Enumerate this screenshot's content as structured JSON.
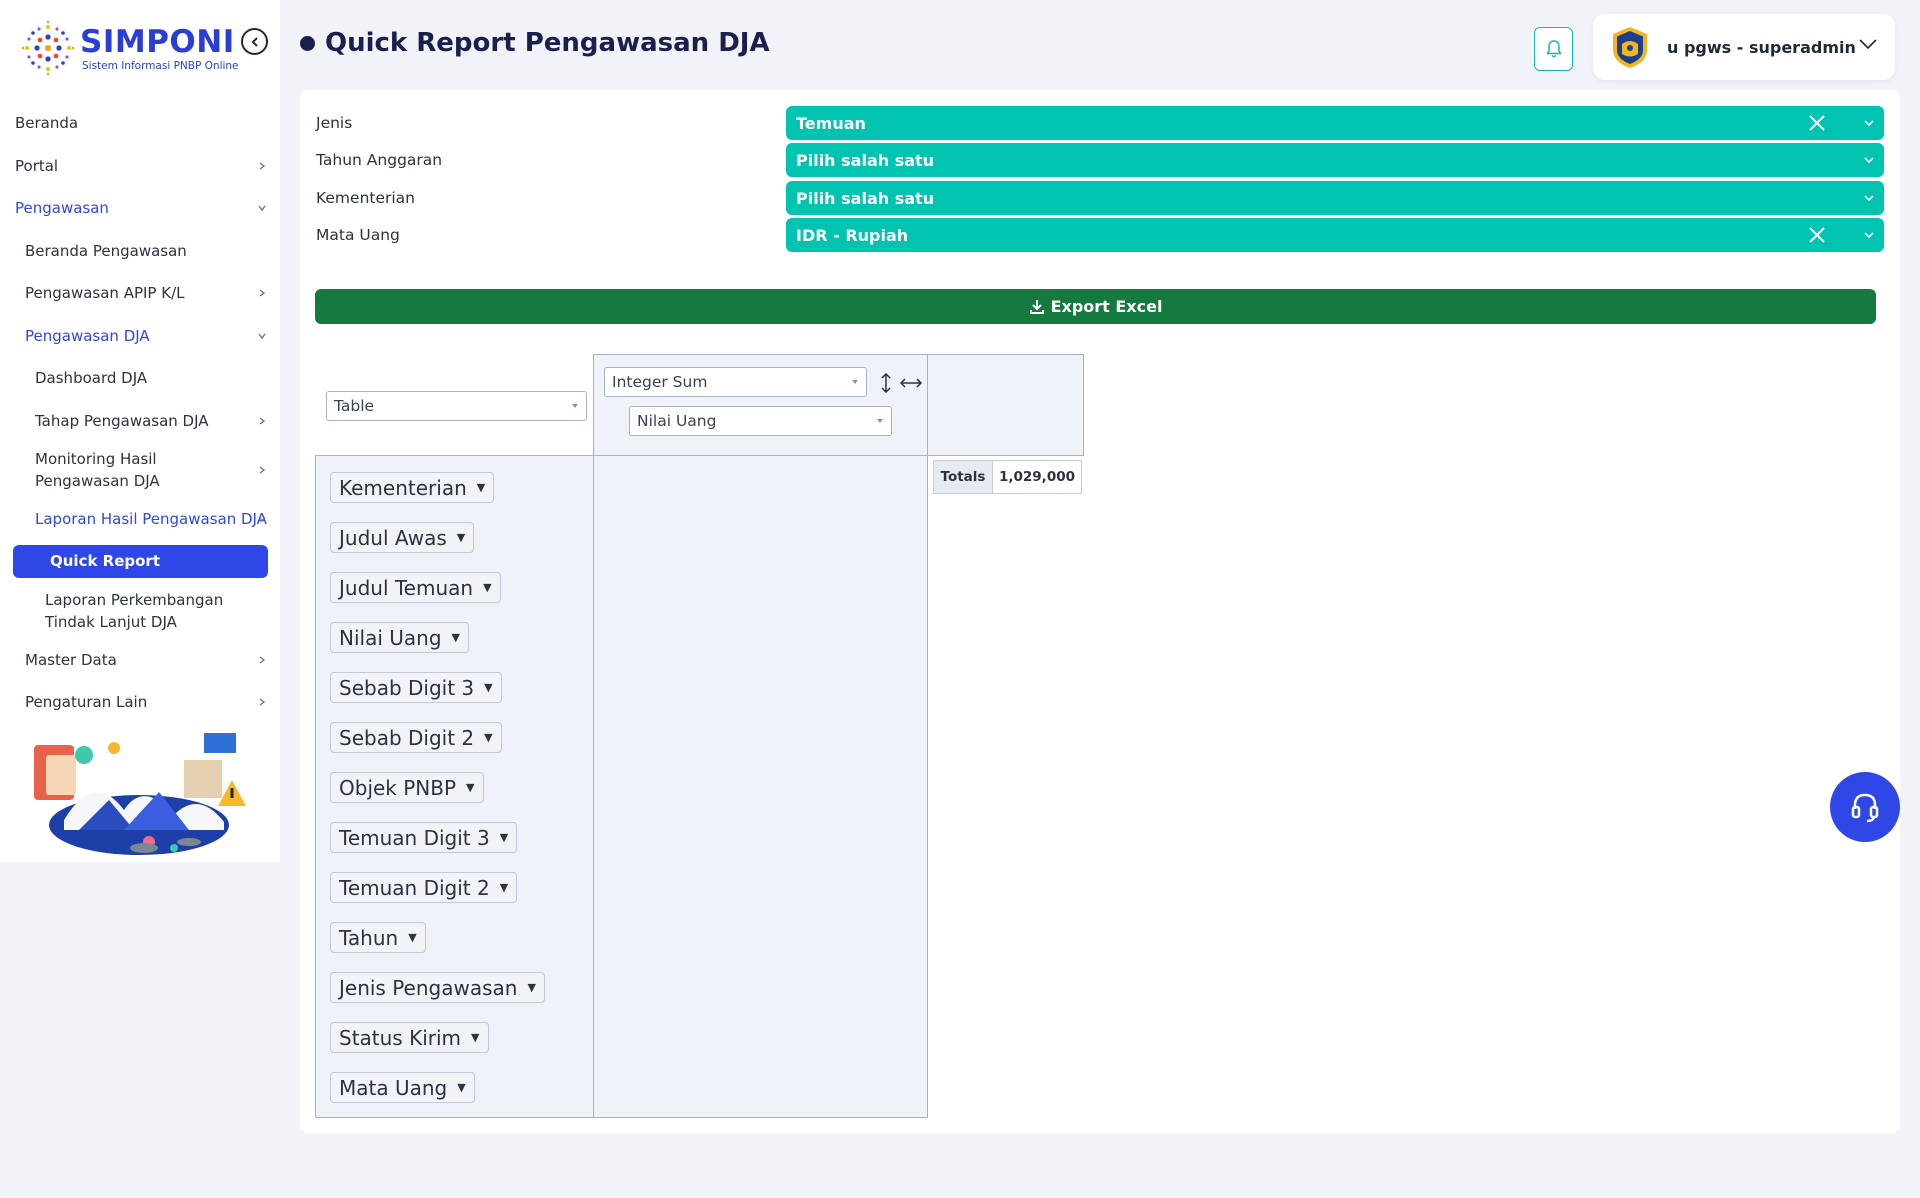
{
  "app": {
    "logo_title": "SIMPONI",
    "logo_subtitle": "Sistem Informasi PNBP Online",
    "brand_color": "#2a3ed6",
    "accent_color": "#00c4b0"
  },
  "header": {
    "page_title": "Quick Report Pengawasan DJA",
    "user_name": "u pgws - superadmin"
  },
  "sidebar": {
    "items": [
      {
        "label": "Beranda"
      },
      {
        "label": "Portal"
      },
      {
        "label": "Pengawasan"
      },
      {
        "label": "Beranda Pengawasan"
      },
      {
        "label": "Pengawasan APIP K/L"
      },
      {
        "label": "Pengawasan DJA"
      },
      {
        "label": "Dashboard DJA"
      },
      {
        "label": "Tahap Pengawasan DJA"
      },
      {
        "label": "Monitoring Hasil Pengawasan DJA"
      },
      {
        "label": "Laporan Hasil Pengawasan DJA"
      },
      {
        "label": "Quick Report"
      },
      {
        "label": "Laporan Perkembangan Tindak Lanjut DJA"
      },
      {
        "label": "Master Data"
      },
      {
        "label": "Pengaturan Lain"
      }
    ]
  },
  "filters": [
    {
      "label": "Jenis",
      "value": "Temuan"
    },
    {
      "label": "Tahun Anggaran",
      "value": "Pilih salah satu"
    },
    {
      "label": "Kementerian",
      "value": "Pilih salah satu"
    },
    {
      "label": "Mata Uang",
      "value": "IDR - Rupiah"
    }
  ],
  "export_label": "Export Excel",
  "pivot": {
    "renderer": "Table",
    "aggregator": "Integer Sum",
    "value_field": "Nilai Uang",
    "attributes": [
      "Kementerian",
      "Judul Awas",
      "Judul Temuan",
      "Nilai Uang",
      "Sebab Digit 3",
      "Sebab Digit 2",
      "Objek PNBP",
      "Temuan Digit 3",
      "Temuan Digit 2",
      "Tahun",
      "Jenis Pengawasan",
      "Status Kirim",
      "Mata Uang"
    ],
    "totals_label": "Totals",
    "totals_value": "1,029,000"
  }
}
